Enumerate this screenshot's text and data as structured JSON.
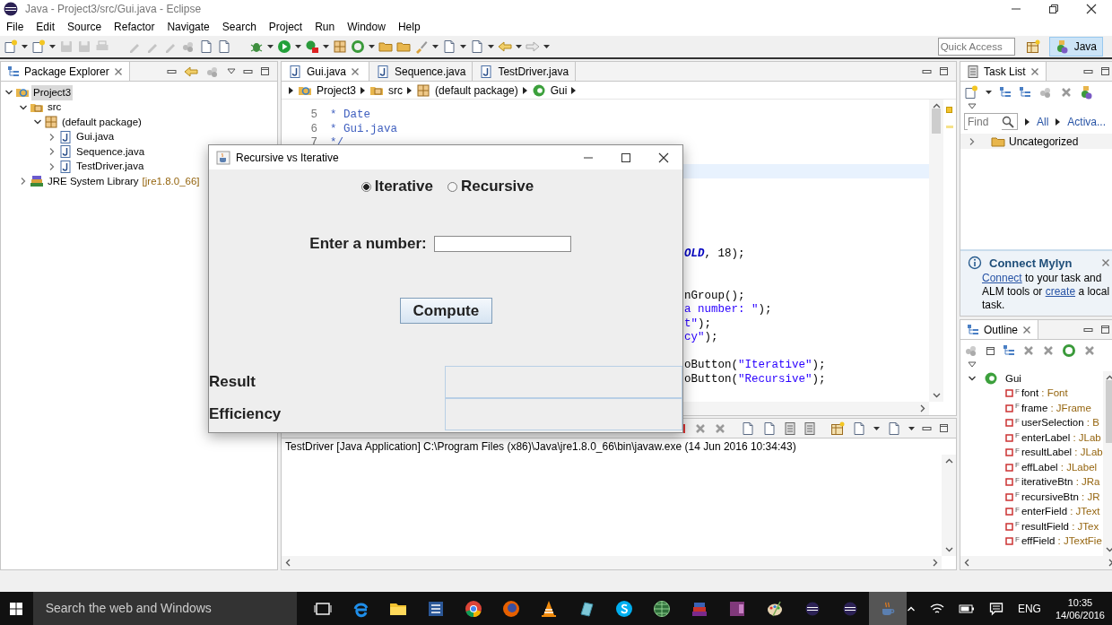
{
  "window": {
    "title": "Java - Project3/src/Gui.java - Eclipse"
  },
  "menu": [
    "File",
    "Edit",
    "Source",
    "Refactor",
    "Navigate",
    "Search",
    "Project",
    "Run",
    "Window",
    "Help"
  ],
  "quick_access": {
    "placeholder": "Quick Access"
  },
  "perspective": {
    "label": "Java",
    "selected": true
  },
  "package_explorer": {
    "title": "Package Explorer",
    "tree": [
      {
        "label": "Project3",
        "kind": "project",
        "expanded": true,
        "selected": true,
        "children": [
          {
            "label": "src",
            "kind": "source-folder",
            "expanded": true,
            "selected": false,
            "children": [
              {
                "label": "(default package)",
                "kind": "package",
                "expanded": true,
                "selected": false,
                "children": [
                  {
                    "label": "Gui.java",
                    "kind": "java-file",
                    "expanded": false,
                    "selected": false
                  },
                  {
                    "label": "Sequence.java",
                    "kind": "java-file",
                    "expanded": false,
                    "selected": false
                  },
                  {
                    "label": "TestDriver.java",
                    "kind": "java-file",
                    "expanded": false,
                    "selected": false
                  }
                ]
              }
            ]
          },
          {
            "label": "JRE System Library",
            "suffix": "[jre1.8.0_66]",
            "kind": "library",
            "expanded": false,
            "selected": false
          }
        ]
      }
    ]
  },
  "editor": {
    "tabs": [
      {
        "label": "Gui.java",
        "selected": true
      },
      {
        "label": "Sequence.java",
        "selected": false
      },
      {
        "label": "TestDriver.java",
        "selected": false
      }
    ],
    "breadcrumb": [
      {
        "label": "Project3",
        "kind": "project"
      },
      {
        "label": "src",
        "kind": "source-folder"
      },
      {
        "label": "(default package)",
        "kind": "package"
      },
      {
        "label": "Gui",
        "kind": "class"
      }
    ],
    "lines": [
      {
        "number": "5",
        "segments": [
          {
            "text": "* Date",
            "kind": "comment"
          }
        ]
      },
      {
        "number": "6",
        "segments": [
          {
            "text": "* Gui.java",
            "kind": "comment"
          }
        ]
      },
      {
        "number": "7",
        "segments": [
          {
            "text": "*/",
            "kind": "comment"
          }
        ]
      },
      {
        "current": true
      },
      {
        "segments": [
          {
            "text": "OLD",
            "kind": "constant"
          },
          {
            "text": ", 18);",
            "kind": "plain"
          }
        ]
      },
      {
        "segments": [
          {
            "text": "nGroup();",
            "kind": "plain"
          }
        ]
      },
      {
        "segments": [
          {
            "text": "a number: \"",
            "kind": "string"
          },
          {
            "text": ");",
            "kind": "plain"
          }
        ]
      },
      {
        "segments": [
          {
            "text": "t\"",
            "kind": "string"
          },
          {
            "text": ");",
            "kind": "plain"
          }
        ]
      },
      {
        "segments": [
          {
            "text": "cy\"",
            "kind": "string"
          },
          {
            "text": ");",
            "kind": "plain"
          }
        ]
      },
      {
        "segments": [
          {
            "text": "oButton(",
            "kind": "plain"
          },
          {
            "text": "\"Iterative\"",
            "kind": "string"
          },
          {
            "text": ");",
            "kind": "plain"
          }
        ]
      },
      {
        "segments": [
          {
            "text": "oButton(",
            "kind": "plain"
          },
          {
            "text": "\"Recursive\"",
            "kind": "string"
          },
          {
            "text": ");",
            "kind": "plain"
          }
        ]
      }
    ]
  },
  "console": {
    "header": "TestDriver [Java Application] C:\\Program Files (x86)\\Java\\jre1.8.0_66\\bin\\javaw.exe (14 Jun 2016 10:34:43)"
  },
  "task_list": {
    "title": "Task List",
    "find": {
      "placeholder": "Find"
    },
    "filters": [
      "All",
      "Activa..."
    ],
    "categories": [
      {
        "label": "Uncategorized",
        "expanded": false
      }
    ],
    "mylyn": {
      "title": "Connect Mylyn",
      "segments": [
        {
          "text": "Connect",
          "kind": "link"
        },
        {
          "text": " to your task and ALM tools or ",
          "kind": "plain"
        },
        {
          "text": "create",
          "kind": "link"
        },
        {
          "text": " a local task.",
          "kind": "plain"
        }
      ]
    }
  },
  "outline": {
    "title": "Outline",
    "root": {
      "label": "Gui",
      "expanded": true,
      "children": [
        {
          "name": "font",
          "type": ": Font",
          "modifier": "F"
        },
        {
          "name": "frame",
          "type": ": JFrame",
          "modifier": "F"
        },
        {
          "name": "userSelection",
          "type": ": B",
          "modifier": "F"
        },
        {
          "name": "enterLabel",
          "type": ": JLab",
          "modifier": "F"
        },
        {
          "name": "resultLabel",
          "type": ": JLab",
          "modifier": "F"
        },
        {
          "name": "effLabel",
          "type": ": JLabel",
          "modifier": "F"
        },
        {
          "name": "iterativeBtn",
          "type": ": JRa",
          "modifier": "F"
        },
        {
          "name": "recursiveBtn",
          "type": ": JR",
          "modifier": "F"
        },
        {
          "name": "enterField",
          "type": ": JText",
          "modifier": "F"
        },
        {
          "name": "resultField",
          "type": ": JTex",
          "modifier": "F"
        },
        {
          "name": "effField",
          "type": ": JTextFie",
          "modifier": "F"
        }
      ]
    }
  },
  "dialog": {
    "title": "Recursive vs Iterative",
    "options": [
      {
        "label": "Iterative",
        "selected": true
      },
      {
        "label": "Recursive",
        "selected": false
      }
    ],
    "prompt": "Enter a number:",
    "button": "Compute",
    "outputs": [
      {
        "label": "Result"
      },
      {
        "label": "Efficiency"
      }
    ]
  },
  "taskbar": {
    "search": {
      "placeholder": "Search the web and Windows"
    },
    "apps": [
      {
        "kind": "task-view",
        "selected": false
      },
      {
        "kind": "edge",
        "selected": false
      },
      {
        "kind": "explorer",
        "selected": false
      },
      {
        "kind": "word",
        "selected": false
      },
      {
        "kind": "chrome",
        "selected": false
      },
      {
        "kind": "firefox",
        "selected": false
      },
      {
        "kind": "vlc",
        "selected": false
      },
      {
        "kind": "book",
        "selected": false
      },
      {
        "kind": "skype",
        "selected": false
      },
      {
        "kind": "globe",
        "selected": false
      },
      {
        "kind": "rar",
        "selected": false
      },
      {
        "kind": "onenote",
        "selected": false
      },
      {
        "kind": "paint",
        "selected": false
      },
      {
        "kind": "eclipse",
        "selected": false
      },
      {
        "kind": "eclipse",
        "selected": false
      },
      {
        "kind": "java",
        "selected": true
      }
    ],
    "language": "ENG",
    "time": "10:35",
    "date": "14/06/2016"
  }
}
